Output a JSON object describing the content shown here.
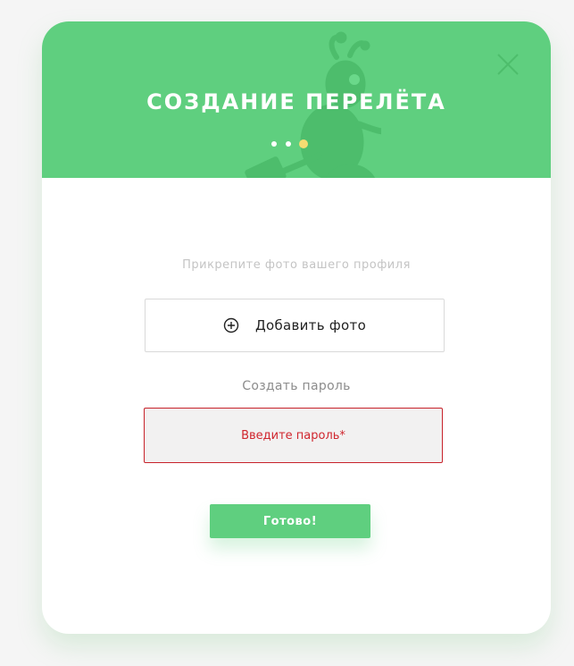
{
  "modal": {
    "title": "СОЗДАНИЕ ПЕРЕЛЁТА",
    "steps": {
      "total": 3,
      "current": 3
    },
    "accent_color": "#5fcf7f",
    "active_step_color": "#f4dc72"
  },
  "photo": {
    "hint": "Прикрепите фото вашего профиля",
    "add_label": "Добавить фото"
  },
  "password": {
    "label": "Создать пароль",
    "placeholder": "Введите пароль*",
    "error_color": "#c7222a"
  },
  "actions": {
    "done_label": "Готово!"
  },
  "icons": {
    "close": "close-icon",
    "add": "plus-circle-icon",
    "mascot": "ant-mascot-icon"
  }
}
